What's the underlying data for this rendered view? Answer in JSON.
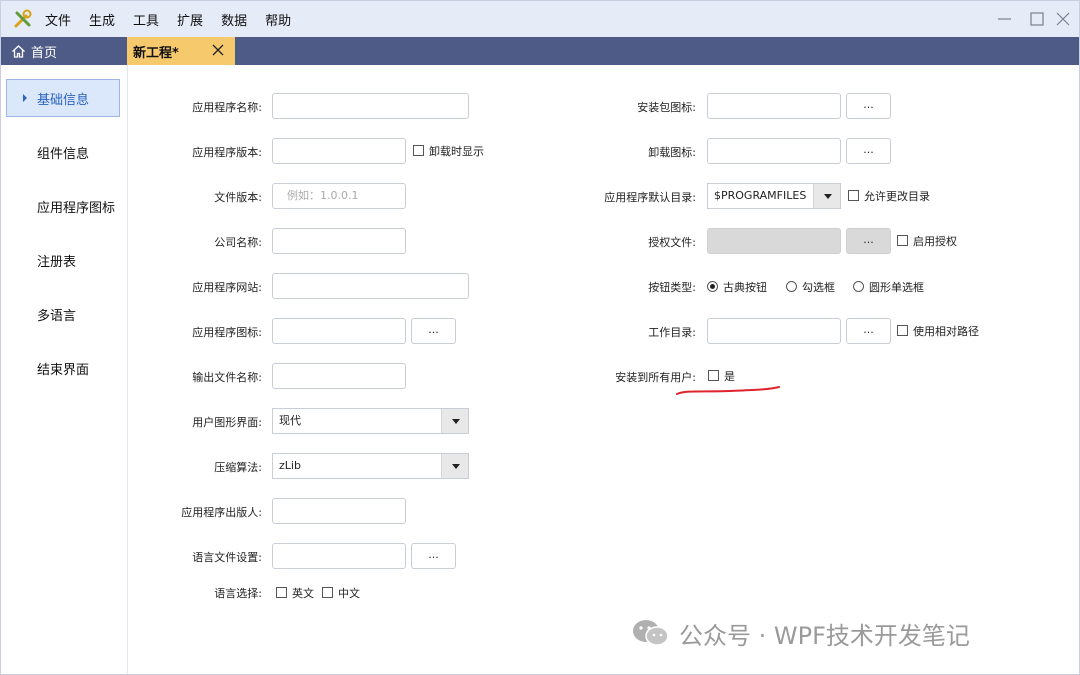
{
  "menu": [
    "文件",
    "生成",
    "工具",
    "扩展",
    "数据",
    "帮助"
  ],
  "tabs": {
    "home": "首页",
    "active": "新工程*"
  },
  "sidebar": [
    "基础信息",
    "组件信息",
    "应用程序图标",
    "注册表",
    "多语言",
    "结束界面"
  ],
  "left_form": {
    "app_name_label": "应用程序名称:",
    "app_version_label": "应用程序版本:",
    "uninstall_show_label": "卸载时显示",
    "file_version_label": "文件版本:",
    "file_version_placeholder": "例如：1.0.0.1",
    "company_label": "公司名称:",
    "website_label": "应用程序网站:",
    "app_icon_label": "应用程序图标:",
    "output_name_label": "输出文件名称:",
    "gui_label": "用户图形界面:",
    "gui_value": "现代",
    "compression_label": "压缩算法:",
    "compression_value": "zLib",
    "publisher_label": "应用程序出版人:",
    "lang_file_label": "语言文件设置:",
    "lang_select_label": "语言选择:",
    "lang_en": "英文",
    "lang_zh": "中文",
    "browse": "..."
  },
  "right_form": {
    "pkg_icon_label": "安装包图标:",
    "uninstall_icon_label": "卸载图标:",
    "default_dir_label": "应用程序默认目录:",
    "default_dir_value": "$PROGRAMFILES",
    "allow_change_label": "允许更改目录",
    "license_label": "授权文件:",
    "enable_license_label": "启用授权",
    "button_type_label": "按钮类型:",
    "button_types": [
      "古典按钮",
      "勾选框",
      "圆形单选框"
    ],
    "workdir_label": "工作目录:",
    "relative_path_label": "使用相对路径",
    "all_users_label": "安装到所有用户:",
    "all_users_yes": "是",
    "browse": "..."
  },
  "watermark": "公众号 · WPF技术开发笔记",
  "colors": {
    "title_bg": "#e6ebf8",
    "tab_bar": "#4d5b86",
    "active_tab": "#f6c96d",
    "sidebar_active": "#dbe7fb",
    "annotation": "#e0242c"
  }
}
